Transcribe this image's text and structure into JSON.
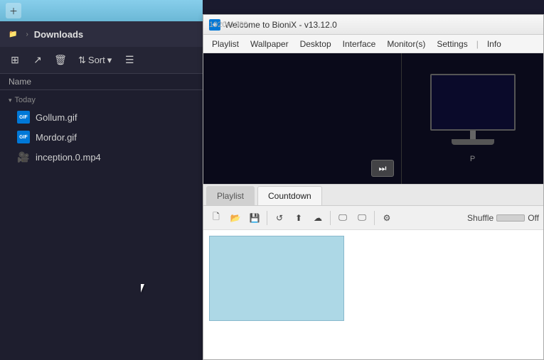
{
  "desktop": {
    "bg_height": 30
  },
  "file_explorer": {
    "taskbar": {
      "new_btn": "＋"
    },
    "nav": {
      "chevron": "›",
      "title": "Downloads"
    },
    "toolbar": {
      "sort_label": "Sort",
      "sort_icon": "⇅"
    },
    "col_header": "Name",
    "sections": [
      {
        "label": "Today",
        "files": [
          {
            "name": "Gollum.gif",
            "type": "gif"
          },
          {
            "name": "Mordor.gif",
            "type": "gif"
          },
          {
            "name": "inception.0.mp4",
            "type": "mp4"
          }
        ]
      }
    ]
  },
  "bionix": {
    "title": "Welcome to BioniX -  v13.12.0",
    "icon": "◈",
    "menu": [
      "Playlist",
      "Wallpaper",
      "Desktop",
      "Interface",
      "Monitor(s)",
      "Settings",
      "|",
      "Info"
    ],
    "resolution": "1920x1080",
    "monitor_label": "P",
    "play_next": "⏭",
    "tabs": [
      {
        "label": "Playlist",
        "active": false
      },
      {
        "label": "Countdown",
        "active": true
      }
    ],
    "toolbar2_buttons": [
      "🗋",
      "📂",
      "💾",
      "↺",
      "⬆",
      "☁",
      "🖵",
      "🖵",
      "⚙"
    ],
    "shuffle": {
      "label": "Shuffle",
      "state": "Off"
    }
  }
}
